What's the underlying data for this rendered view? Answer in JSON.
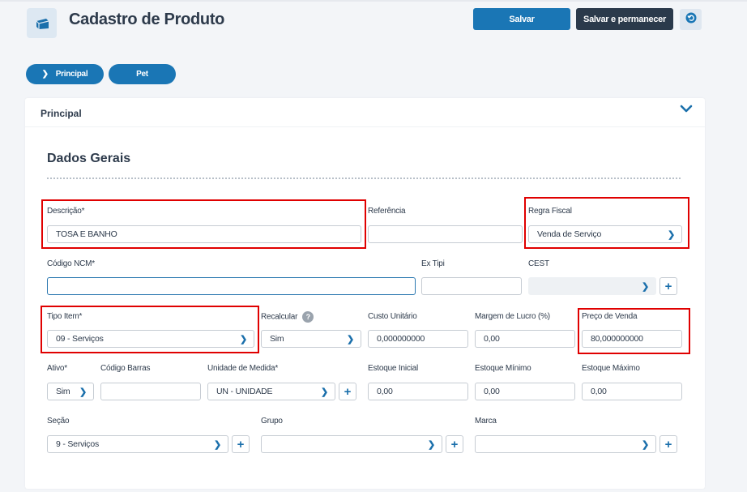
{
  "header": {
    "title": "Cadastro de Produto",
    "save_label": "Salvar",
    "save_stay_label": "Salvar e permanecer"
  },
  "tabs": [
    {
      "label": "Principal",
      "active": true
    },
    {
      "label": "Pet",
      "active": false
    }
  ],
  "section": {
    "header_label": "Principal",
    "title": "Dados Gerais"
  },
  "fields": {
    "descricao": {
      "label": "Descrição*",
      "value": "TOSA E BANHO"
    },
    "referencia": {
      "label": "Referência",
      "value": ""
    },
    "regra_fiscal": {
      "label": "Regra Fiscal",
      "value": "Venda de Serviço"
    },
    "codigo_ncm": {
      "label": "Código NCM*",
      "value": ""
    },
    "ex_tipi": {
      "label": "Ex Tipi",
      "value": ""
    },
    "cest": {
      "label": "CEST",
      "value": ""
    },
    "tipo_item": {
      "label": "Tipo Item*",
      "value": "09 - Serviços"
    },
    "recalcular": {
      "label": "Recalcular",
      "value": "Sim"
    },
    "custo_unitario": {
      "label": "Custo Unitário",
      "value": "0,000000000"
    },
    "margem_lucro": {
      "label": "Margem de Lucro (%)",
      "value": "0,00"
    },
    "preco_venda": {
      "label": "Preço de Venda",
      "value": "80,000000000"
    },
    "ativo": {
      "label": "Ativo*",
      "value": "Sim"
    },
    "codigo_barras": {
      "label": "Código Barras",
      "value": ""
    },
    "unidade_medida": {
      "label": "Unidade de Medida*",
      "value": "UN - UNIDADE"
    },
    "estoque_inicial": {
      "label": "Estoque Inicial",
      "value": "0,00"
    },
    "estoque_minimo": {
      "label": "Estoque Mínimo",
      "value": "0,00"
    },
    "estoque_maximo": {
      "label": "Estoque Máximo",
      "value": "0,00"
    },
    "secao": {
      "label": "Seção",
      "value": "9 - Serviços"
    },
    "grupo": {
      "label": "Grupo",
      "value": ""
    },
    "marca": {
      "label": "Marca",
      "value": ""
    }
  },
  "help_glyph": "?",
  "icons": {
    "logo": "box-icon",
    "undo": "undo-icon",
    "chevron": "chevron-right-icon",
    "plus": "plus-icon",
    "collapse": "chevron-down-icon"
  },
  "colors": {
    "primary": "#1a76b5",
    "dark": "#2b3a4b",
    "highlight": "#e00000"
  }
}
